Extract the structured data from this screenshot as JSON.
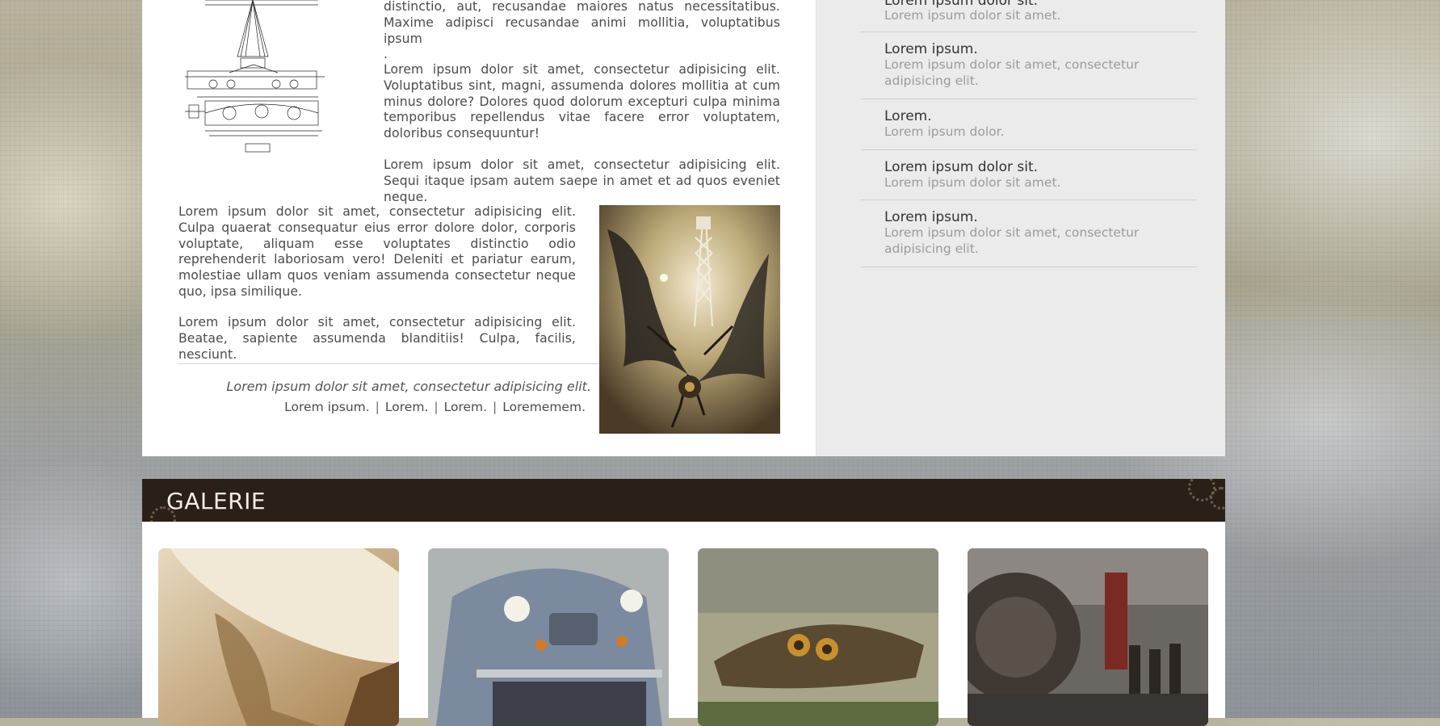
{
  "article": {
    "para_top_1": "distinctio, aut, recusandae maiores natus necessitatibus.",
    "para_top_2": "Maxime adipisci recusandae animi mollitia, voluptatibus ipsum",
    "para_top_3": ".",
    "para2": "Lorem ipsum dolor sit amet, consectetur adipisicing elit. Voluptatibus sint, magni, assumenda dolores mollitia at cum minus dolore? Dolores quod dolorum excepturi culpa minima temporibus repellendus vitae facere error voluptatem, doloribus consequuntur!",
    "para3": "Lorem ipsum dolor sit amet, consectetur adipisicing elit. Sequi itaque ipsam autem saepe in amet et ad quos eveniet neque.",
    "para4": "Lorem ipsum dolor sit amet, consectetur adipisicing elit. Culpa quaerat consequatur eius error dolore dolor, corporis voluptate, aliquam esse voluptates distinctio odio reprehenderit laboriosam vero! Deleniti et pariatur earum, molestiae ullam quos veniam assumenda consectetur neque quo, ipsa similique.",
    "para5": "Lorem ipsum dolor sit amet, consectetur adipisicing elit. Beatae, sapiente assumenda blanditiis! Culpa, facilis, nesciunt.",
    "quote": "Lorem ipsum dolor sit amet, consectetur adipisicing elit.",
    "links": [
      "Lorem ipsum.",
      "Lorem.",
      "Lorem.",
      "Lorememem."
    ],
    "link_separator": "|"
  },
  "sidebar": {
    "items": [
      {
        "title": "Lorem ipsum dolor sit.",
        "desc": "Lorem ipsum dolor sit amet."
      },
      {
        "title": "Lorem ipsum.",
        "desc": "Lorem ipsum dolor sit amet, consectetur adipisicing elit."
      },
      {
        "title": "Lorem.",
        "desc": "Lorem ipsum dolor."
      },
      {
        "title": "Lorem ipsum dolor sit.",
        "desc": "Lorem ipsum dolor sit amet."
      },
      {
        "title": "Lorem ipsum.",
        "desc": "Lorem ipsum dolor sit amet, consectetur adipisicing elit."
      }
    ]
  },
  "gallery": {
    "title": "GALERIE"
  },
  "colors": {
    "gallery_header_bg": "#2b2017",
    "sidebar_bg": "#ebebeb",
    "text_main": "#4b4b4b",
    "text_muted": "#9b9b9b"
  }
}
